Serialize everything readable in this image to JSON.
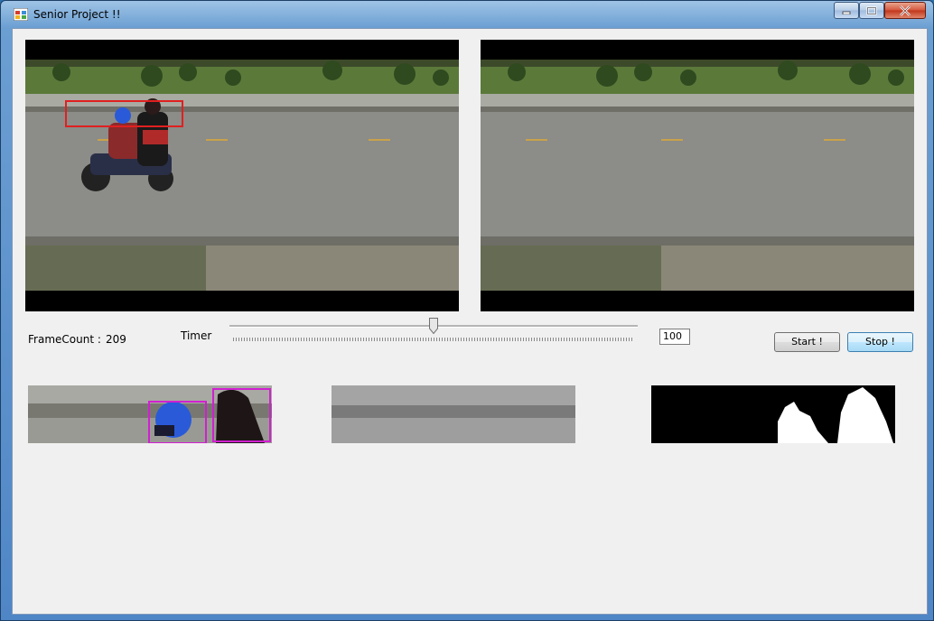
{
  "window": {
    "title": "Senior Project !!",
    "minimize_icon": "minimize-icon",
    "maximize_icon": "maximize-icon",
    "close_icon": "close-icon"
  },
  "stats": {
    "frame_count_label": "FrameCount :",
    "frame_count_value": "209"
  },
  "timer": {
    "label": "Timer",
    "slider_value_fraction": 0.5,
    "interval_value": "100"
  },
  "buttons": {
    "start_label": "Start !",
    "stop_label": "Stop !"
  },
  "colors": {
    "detection_box": "#e02020",
    "face_box": "#d020d0"
  }
}
